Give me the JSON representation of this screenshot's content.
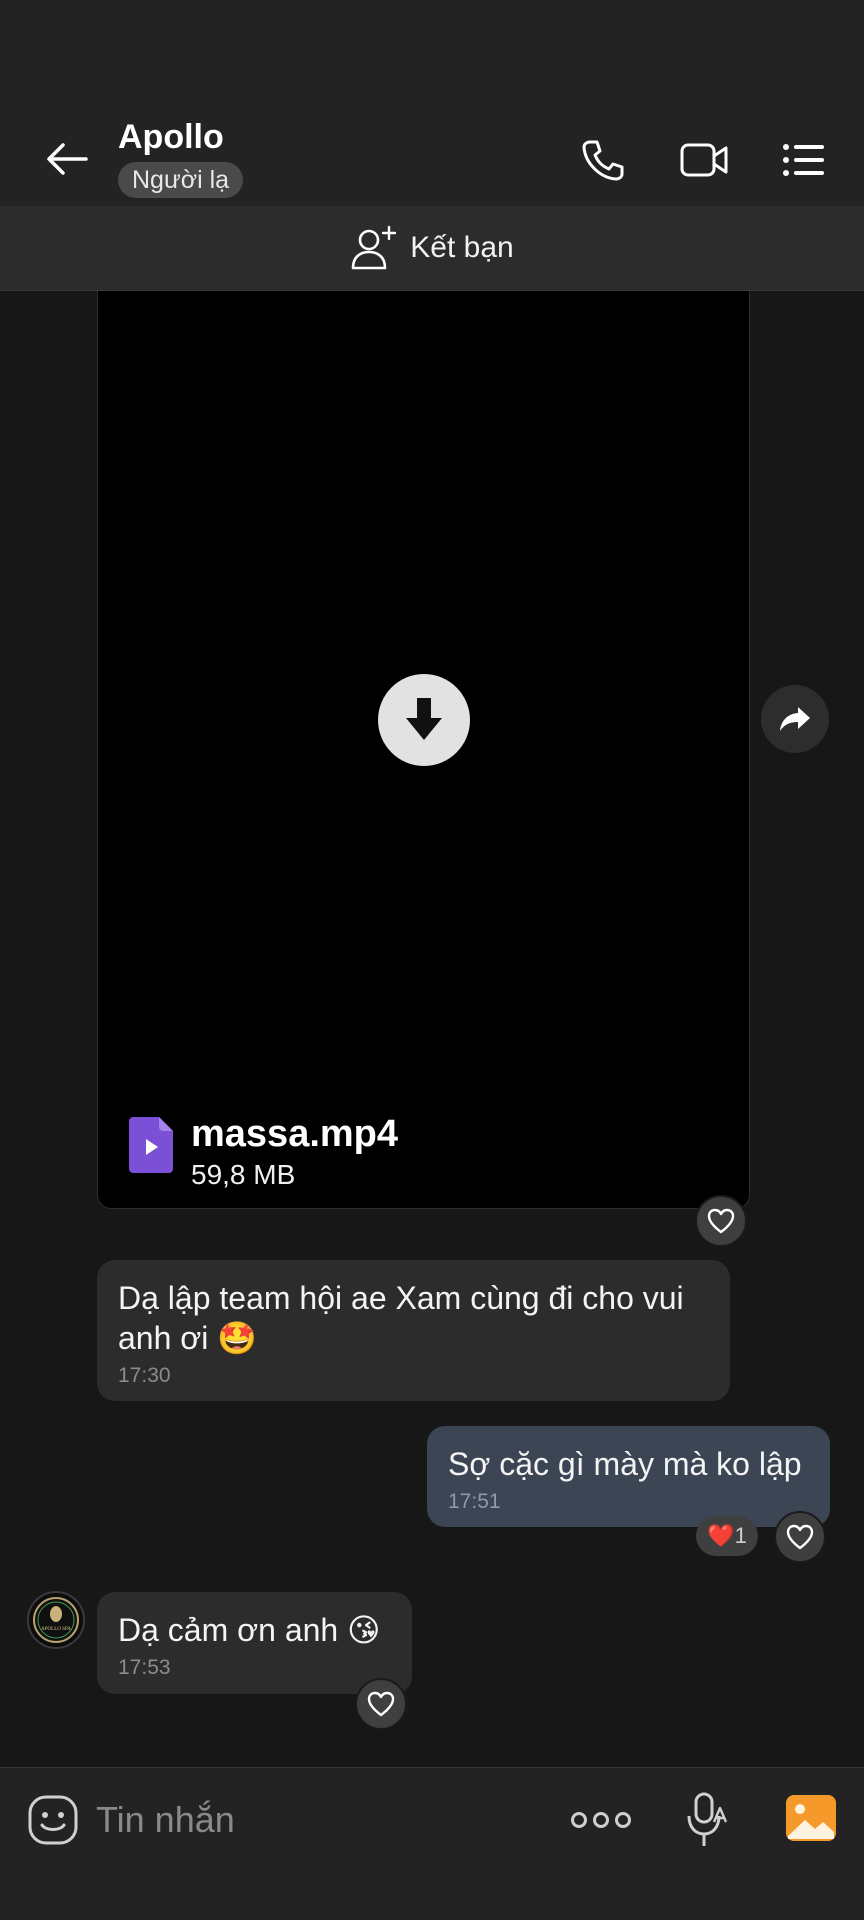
{
  "header": {
    "title": "Apollo",
    "badge": "Người lạ"
  },
  "friend_bar": {
    "label": "Kết bạn"
  },
  "messages": [
    {
      "type": "file",
      "direction": "incoming",
      "file_name": "massa.mp4",
      "file_size": "59,8 MB"
    },
    {
      "type": "text",
      "direction": "incoming",
      "text": "Dạ lập team hội ae Xam cùng đi cho vui anh ơi 🤩",
      "time": "17:30"
    },
    {
      "type": "text",
      "direction": "outgoing",
      "text": "Sợ cặc gì mày mà ko lập",
      "time": "17:51",
      "reaction": {
        "emoji": "❤️",
        "count": "1"
      }
    },
    {
      "type": "text",
      "direction": "incoming",
      "text": "Dạ cảm ơn anh 😘",
      "time": "17:53"
    }
  ],
  "avatar": {
    "text": "APOLLO SPA"
  },
  "input": {
    "placeholder": "Tin nhắn"
  },
  "colors": {
    "background": "#171717",
    "bar": "#232323",
    "incoming_bubble": "#2c2c2c",
    "outgoing_bubble": "#3b4554",
    "file_icon": "#7b4fd6",
    "image_icon": "#f59a2a"
  },
  "icons": [
    "back-arrow-icon",
    "phone-icon",
    "video-call-icon",
    "menu-list-icon",
    "add-friend-icon",
    "download-icon",
    "share-icon",
    "heart-icon",
    "emoji-icon",
    "more-icon",
    "voice-to-text-icon",
    "image-icon"
  ]
}
